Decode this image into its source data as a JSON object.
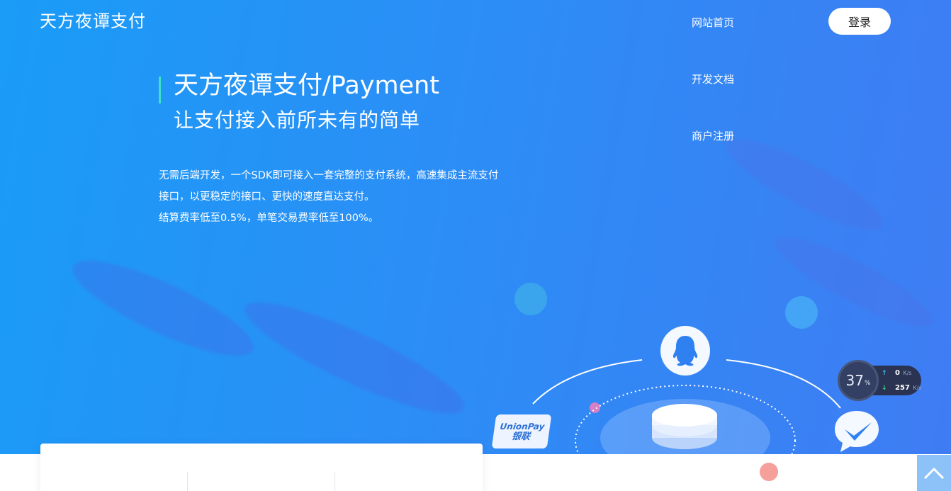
{
  "header": {
    "logo": "天方夜谭支付",
    "nav": [
      {
        "label": "网站首页"
      },
      {
        "label": "开发文档"
      },
      {
        "label": "商户注册"
      }
    ],
    "login_label": "登录"
  },
  "hero": {
    "title": "天方夜谭支付/Payment",
    "subtitle": "让支付接入前所未有的简单",
    "description": [
      "无需后端开发，一个SDK即可接入一套完整的支付系统，高速集成主流支付",
      "接口，以更稳定的接口、更快的速度直达支付。",
      "结算费率低至0.5%，单笔交易费率低至100%。"
    ]
  },
  "illustration": {
    "unionpay_en": "UnionPay",
    "unionpay_cn": "银联",
    "icons": [
      "qq-penguin-icon",
      "chat-check-icon",
      "coin-stack-icon"
    ]
  },
  "speed_widget": {
    "percent": "37",
    "percent_sign": "%",
    "upload": "0",
    "upload_unit": "K/s",
    "download": "257",
    "download_unit": "K/s"
  },
  "colors": {
    "hero_start": "#1a9cf7",
    "hero_end": "#3f7cf3",
    "accent_bar": "#3ee0c8"
  }
}
